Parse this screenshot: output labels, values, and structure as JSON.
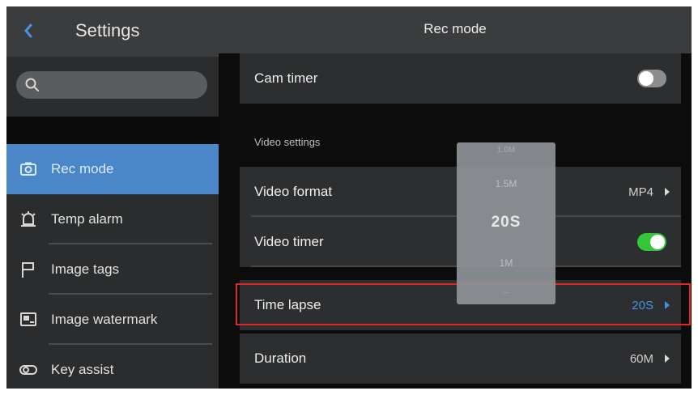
{
  "sidebar": {
    "title": "Settings",
    "back_icon": "chevron-left-icon",
    "search_icon": "search-icon",
    "items": [
      {
        "label": "Rec mode",
        "icon": "camera-icon",
        "active": true
      },
      {
        "label": "Temp alarm",
        "icon": "alarm-icon",
        "active": false
      },
      {
        "label": "Image tags",
        "icon": "flag-icon",
        "active": false
      },
      {
        "label": "Image watermark",
        "icon": "watermark-icon",
        "active": false
      },
      {
        "label": "Key assist",
        "icon": "key-assist-icon",
        "active": false
      }
    ]
  },
  "main": {
    "title": "Rec mode",
    "cam_timer": {
      "label": "Cam timer",
      "enabled": false
    },
    "section_label": "Video settings",
    "video_format": {
      "label": "Video format",
      "value": "MP4"
    },
    "video_timer": {
      "label": "Video timer",
      "enabled": true
    },
    "time_lapse": {
      "label": "Time lapse",
      "value": "20S"
    },
    "duration": {
      "label": "Duration",
      "value": "60M"
    }
  },
  "picker": {
    "options": [
      "1.0M",
      "1.5M",
      "20S",
      "1M",
      "..."
    ],
    "selected": "20S"
  },
  "colors": {
    "accent": "#4a86c8",
    "toggle_on": "#35c43a",
    "highlight": "#e0262a",
    "value_blue": "#4a90e2"
  }
}
